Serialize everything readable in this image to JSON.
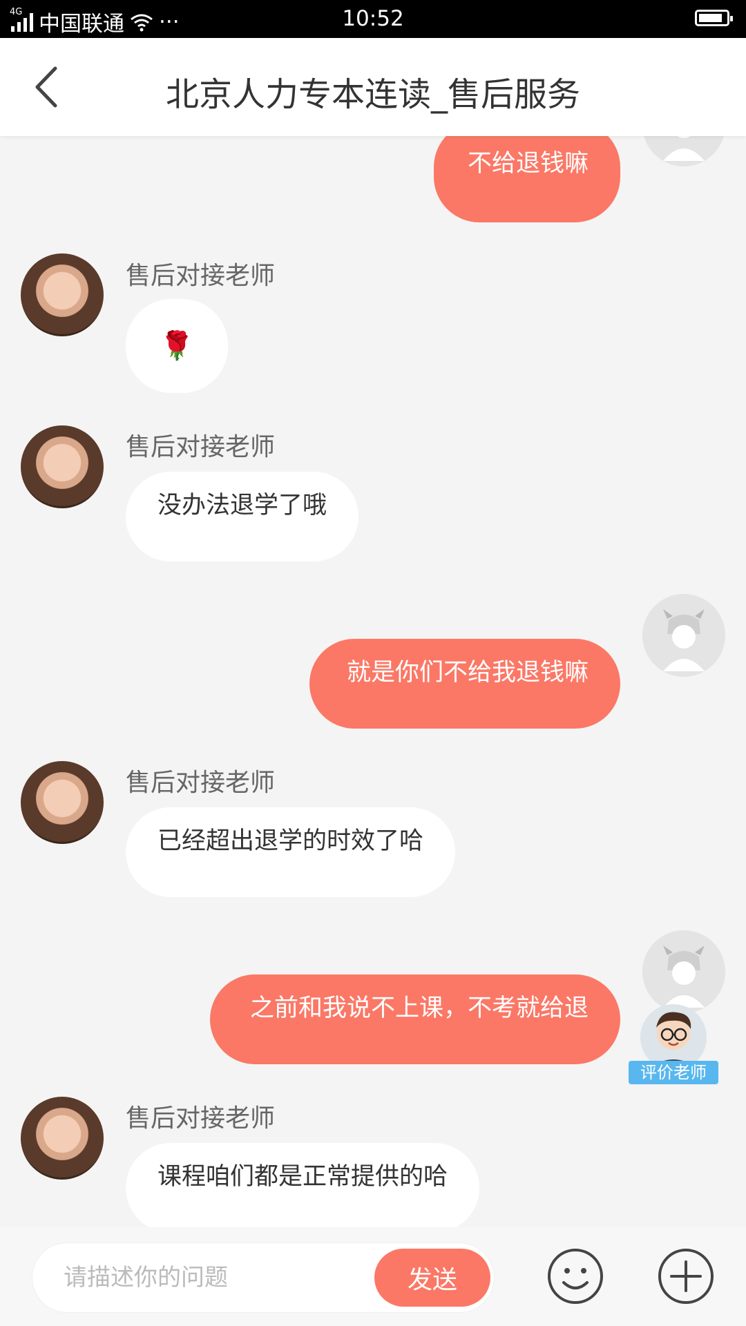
{
  "status_bar": {
    "network": "4G",
    "carrier": "中国联通",
    "more": "···",
    "time": "10:52"
  },
  "header": {
    "title": "北京人力专本连读_售后服务",
    "back_icon": "chevron-left-icon"
  },
  "messages": [
    {
      "side": "out",
      "text": "不给退钱嘛"
    },
    {
      "side": "in",
      "sender": "售后对接老师",
      "text": "🌹"
    },
    {
      "side": "in",
      "sender": "售后对接老师",
      "text": "没办法退学了哦"
    },
    {
      "side": "out",
      "text": "就是你们不给我退钱嘛"
    },
    {
      "side": "in",
      "sender": "售后对接老师",
      "text": "已经超出退学的时效了哈"
    },
    {
      "side": "out",
      "text": "之前和我说不上课，不考就给退"
    },
    {
      "side": "in",
      "sender": "售后对接老师",
      "text": "课程咱们都是正常提供的哈"
    }
  ],
  "rate_badge": {
    "label": "评价老师"
  },
  "composer": {
    "placeholder": "请描述你的问题",
    "send_label": "发送",
    "emoji_icon": "smiley-icon",
    "plus_icon": "plus-circle-icon"
  },
  "colors": {
    "accent": "#fb7866",
    "background": "#f4f4f4",
    "badge": "#58b7ef"
  }
}
